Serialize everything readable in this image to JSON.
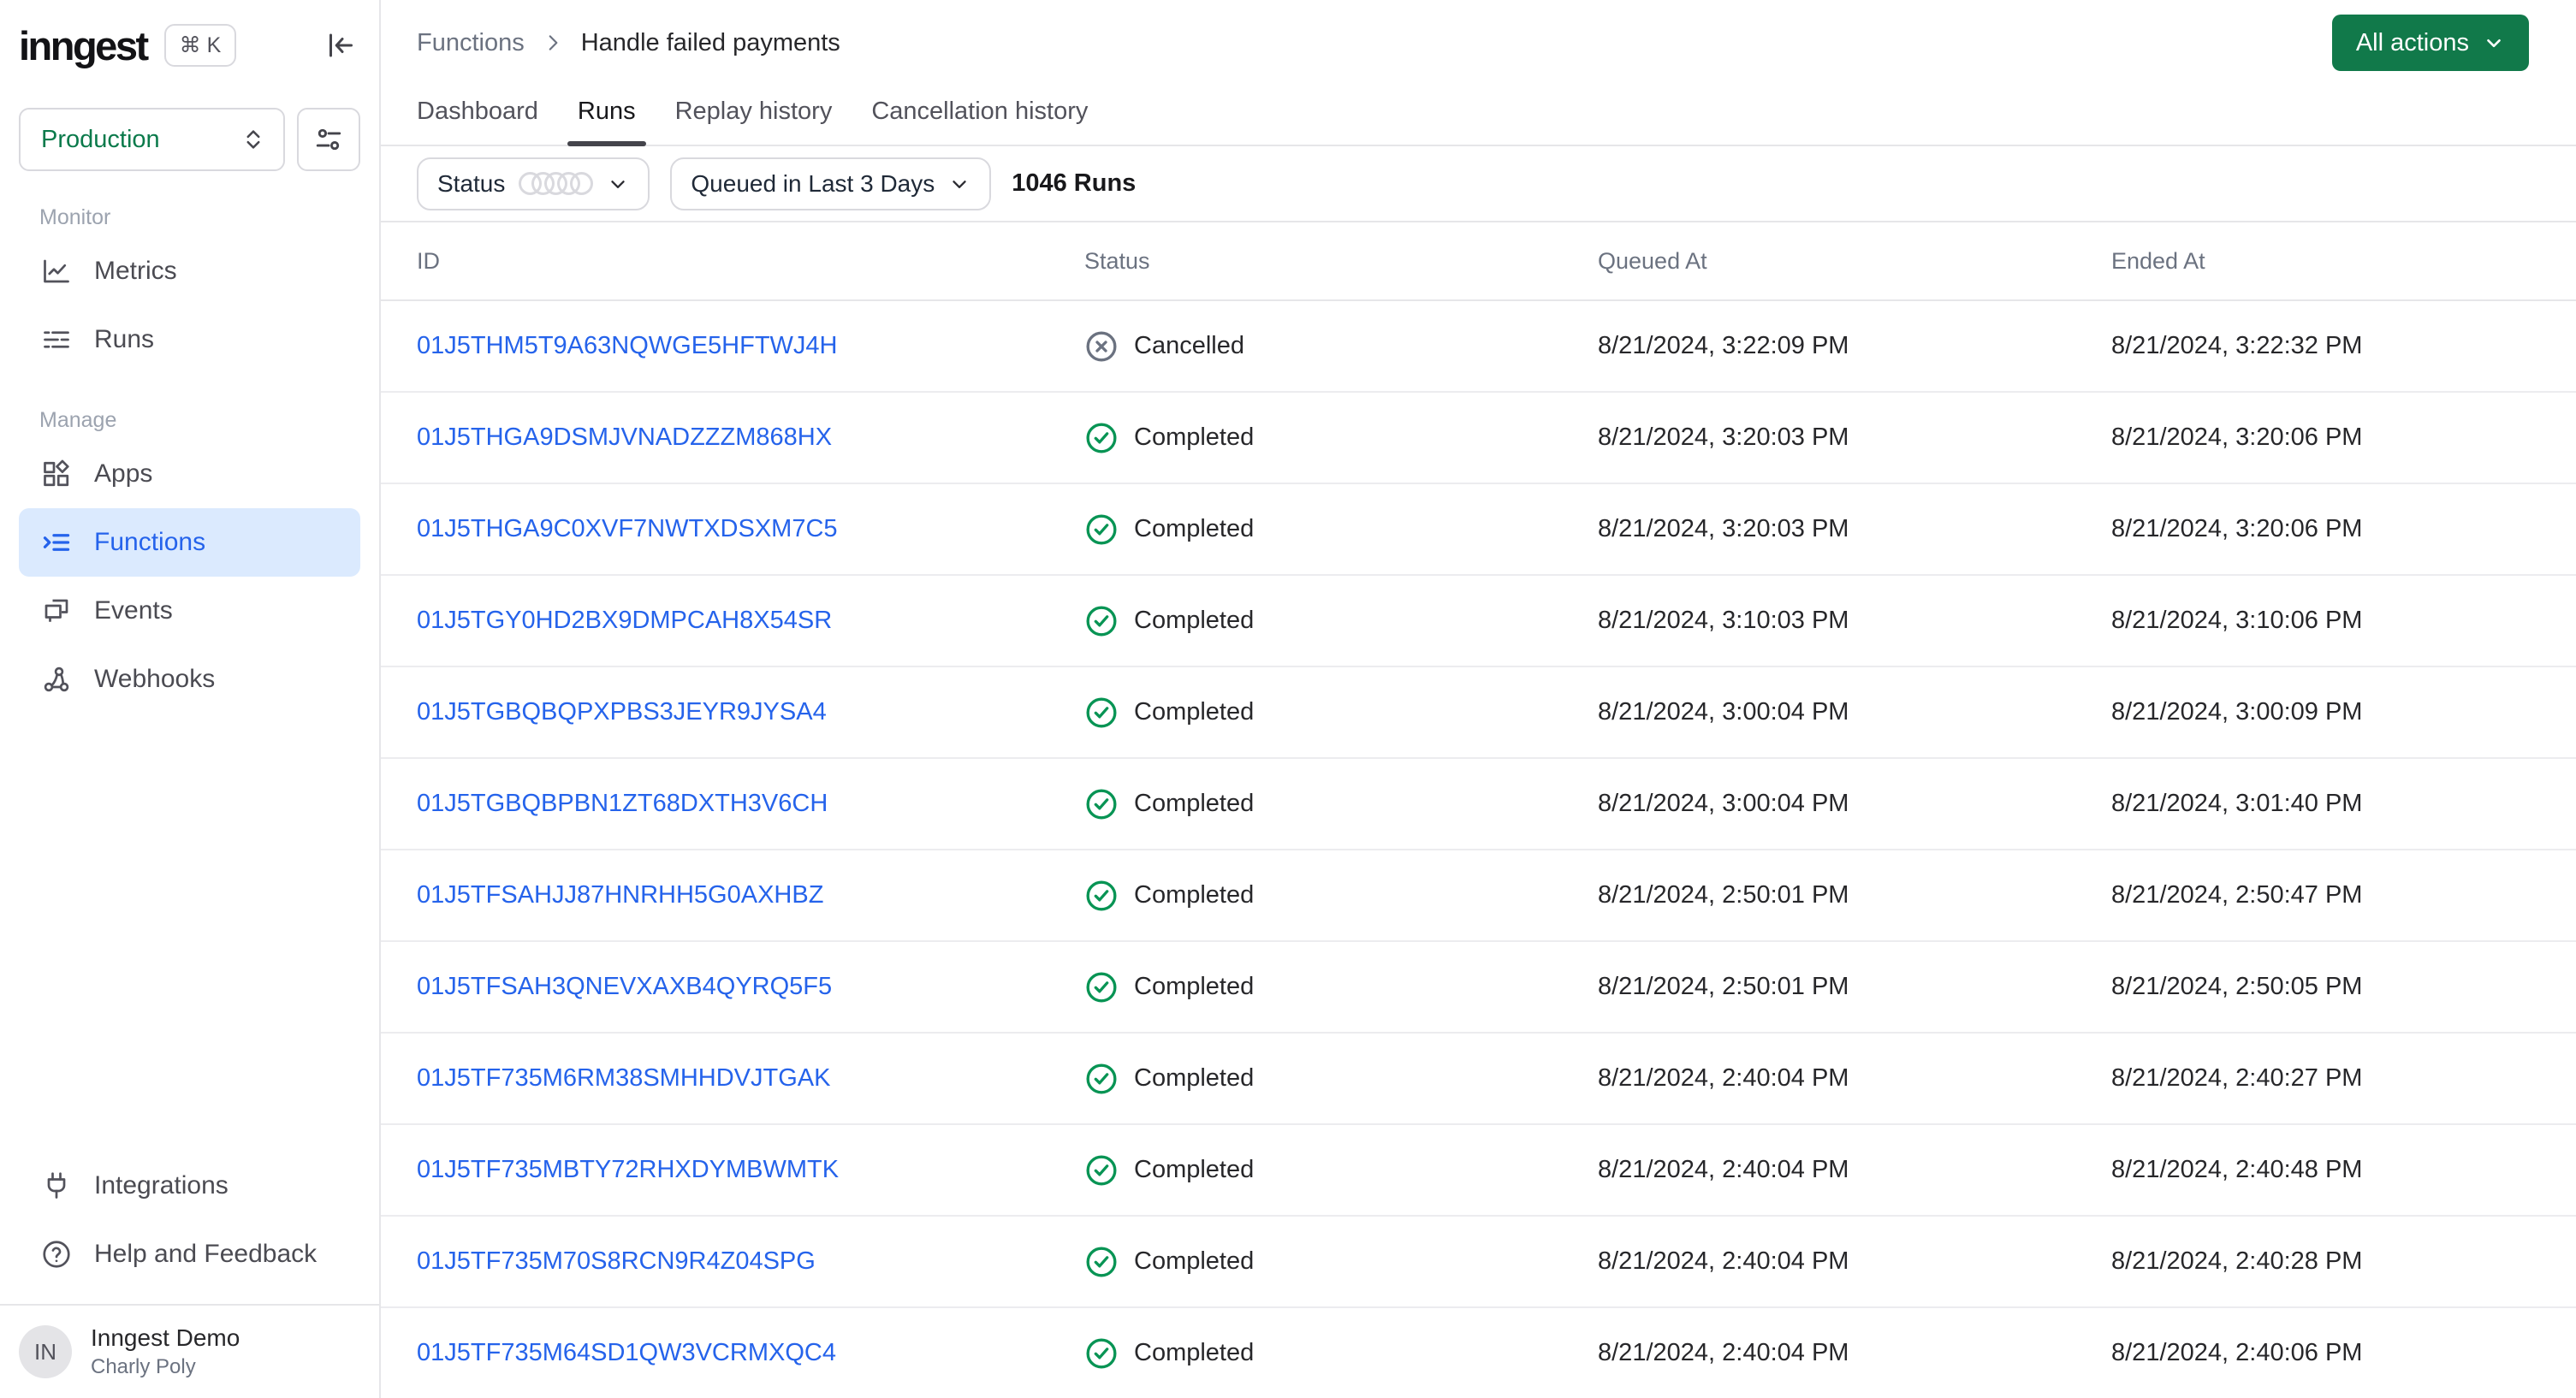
{
  "sidebar": {
    "logo": "inngest",
    "shortcut": "⌘ K",
    "environment": {
      "selected": "Production"
    },
    "sections": [
      {
        "label": "Monitor",
        "items": [
          {
            "label": "Metrics"
          },
          {
            "label": "Runs"
          }
        ]
      },
      {
        "label": "Manage",
        "items": [
          {
            "label": "Apps"
          },
          {
            "label": "Functions",
            "active": true
          },
          {
            "label": "Events"
          },
          {
            "label": "Webhooks"
          }
        ]
      }
    ],
    "footer_items": [
      {
        "label": "Integrations"
      },
      {
        "label": "Help and Feedback"
      }
    ],
    "user": {
      "initials": "IN",
      "org": "Inngest Demo",
      "name": "Charly Poly"
    }
  },
  "header": {
    "breadcrumb": {
      "root": "Functions",
      "current": "Handle failed payments"
    },
    "actions_button": "All actions",
    "tabs": [
      {
        "label": "Dashboard"
      },
      {
        "label": "Runs",
        "active": true
      },
      {
        "label": "Replay history"
      },
      {
        "label": "Cancellation history"
      }
    ]
  },
  "filters": {
    "status_label": "Status",
    "time_filter": "Queued in Last 3 Days",
    "runs_count": "1046 Runs"
  },
  "table": {
    "columns": [
      "ID",
      "Status",
      "Queued At",
      "Ended At"
    ],
    "rows": [
      {
        "id": "01J5THM5T9A63NQWGE5HFTWJ4H",
        "status": "Cancelled",
        "queued_at": "8/21/2024, 3:22:09 PM",
        "ended_at": "8/21/2024, 3:22:32 PM"
      },
      {
        "id": "01J5THGA9DSMJVNADZZZM868HX",
        "status": "Completed",
        "queued_at": "8/21/2024, 3:20:03 PM",
        "ended_at": "8/21/2024, 3:20:06 PM"
      },
      {
        "id": "01J5THGA9C0XVF7NWTXDSXM7C5",
        "status": "Completed",
        "queued_at": "8/21/2024, 3:20:03 PM",
        "ended_at": "8/21/2024, 3:20:06 PM"
      },
      {
        "id": "01J5TGY0HD2BX9DMPCAH8X54SR",
        "status": "Completed",
        "queued_at": "8/21/2024, 3:10:03 PM",
        "ended_at": "8/21/2024, 3:10:06 PM"
      },
      {
        "id": "01J5TGBQBQPXPBS3JEYR9JYSA4",
        "status": "Completed",
        "queued_at": "8/21/2024, 3:00:04 PM",
        "ended_at": "8/21/2024, 3:00:09 PM"
      },
      {
        "id": "01J5TGBQBPBN1ZT68DXTH3V6CH",
        "status": "Completed",
        "queued_at": "8/21/2024, 3:00:04 PM",
        "ended_at": "8/21/2024, 3:01:40 PM"
      },
      {
        "id": "01J5TFSAHJJ87HNRHH5G0AXHBZ",
        "status": "Completed",
        "queued_at": "8/21/2024, 2:50:01 PM",
        "ended_at": "8/21/2024, 2:50:47 PM"
      },
      {
        "id": "01J5TFSAH3QNEVXAXB4QYRQ5F5",
        "status": "Completed",
        "queued_at": "8/21/2024, 2:50:01 PM",
        "ended_at": "8/21/2024, 2:50:05 PM"
      },
      {
        "id": "01J5TF735M6RM38SMHHDVJTGAK",
        "status": "Completed",
        "queued_at": "8/21/2024, 2:40:04 PM",
        "ended_at": "8/21/2024, 2:40:27 PM"
      },
      {
        "id": "01J5TF735MBTY72RHXDYMBWMTK",
        "status": "Completed",
        "queued_at": "8/21/2024, 2:40:04 PM",
        "ended_at": "8/21/2024, 2:40:48 PM"
      },
      {
        "id": "01J5TF735M70S8RCN9R4Z04SPG",
        "status": "Completed",
        "queued_at": "8/21/2024, 2:40:04 PM",
        "ended_at": "8/21/2024, 2:40:28 PM"
      },
      {
        "id": "01J5TF735M64SD1QW3VCRMXQC4",
        "status": "Completed",
        "queued_at": "8/21/2024, 2:40:04 PM",
        "ended_at": "8/21/2024, 2:40:06 PM"
      }
    ]
  },
  "colors": {
    "accent_green": "#11794a",
    "success_green": "#089454",
    "link_blue": "#2563eb",
    "active_bg": "#dbeafe",
    "border": "#e6e6e9",
    "muted_text": "#6b7280"
  }
}
